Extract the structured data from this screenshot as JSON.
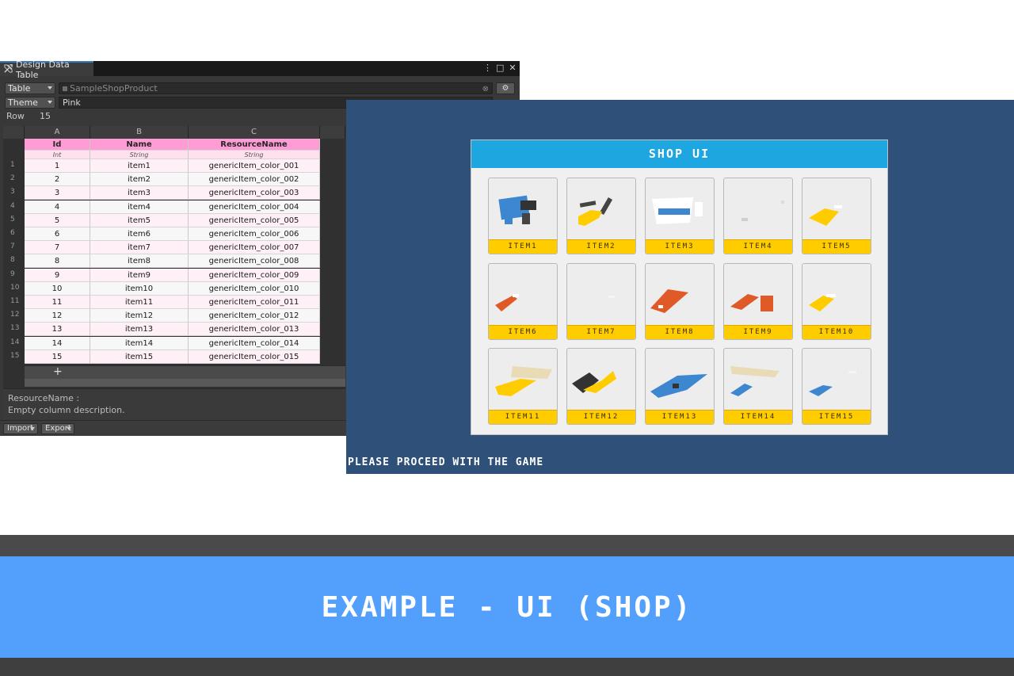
{
  "editor": {
    "tab_title": "Design Data Table",
    "win_buttons": {
      "menu": "⋮",
      "maximize": "□",
      "close": "✕"
    },
    "table_dropdown": "Table",
    "table_source": "SampleShopProduct",
    "theme_dropdown": "Theme",
    "theme_value": "Pink",
    "row_label": "Row",
    "row_value": "15",
    "columns": [
      {
        "letter": "A",
        "name": "Id",
        "type": "Int"
      },
      {
        "letter": "B",
        "name": "Name",
        "type": "String"
      },
      {
        "letter": "C",
        "name": "ResourceName",
        "type": "String"
      }
    ],
    "rows": [
      {
        "num": "1",
        "id": "1",
        "name": "item1",
        "resource": "genericItem_color_001"
      },
      {
        "num": "2",
        "id": "2",
        "name": "item2",
        "resource": "genericItem_color_002"
      },
      {
        "num": "3",
        "id": "3",
        "name": "item3",
        "resource": "genericItem_color_003"
      },
      {
        "num": "4",
        "id": "4",
        "name": "item4",
        "resource": "genericItem_color_004"
      },
      {
        "num": "5",
        "id": "5",
        "name": "item5",
        "resource": "genericItem_color_005"
      },
      {
        "num": "6",
        "id": "6",
        "name": "item6",
        "resource": "genericItem_color_006"
      },
      {
        "num": "7",
        "id": "7",
        "name": "item7",
        "resource": "genericItem_color_007"
      },
      {
        "num": "8",
        "id": "8",
        "name": "item8",
        "resource": "genericItem_color_008"
      },
      {
        "num": "9",
        "id": "9",
        "name": "item9",
        "resource": "genericItem_color_009"
      },
      {
        "num": "10",
        "id": "10",
        "name": "item10",
        "resource": "genericItem_color_010"
      },
      {
        "num": "11",
        "id": "11",
        "name": "item11",
        "resource": "genericItem_color_011"
      },
      {
        "num": "12",
        "id": "12",
        "name": "item12",
        "resource": "genericItem_color_012"
      },
      {
        "num": "13",
        "id": "13",
        "name": "item13",
        "resource": "genericItem_color_013"
      },
      {
        "num": "14",
        "id": "14",
        "name": "item14",
        "resource": "genericItem_color_014"
      },
      {
        "num": "15",
        "id": "15",
        "name": "item15",
        "resource": "genericItem_color_015"
      }
    ],
    "add_row_symbol": "+",
    "description_title": "ResourceName :",
    "description_text": "Empty column description.",
    "import_button": "Import",
    "export_button": "Export",
    "colors": {
      "header_pink": "#ff9cd6",
      "row_pink": "#fff0f7",
      "tab_accent": "#3a79bb"
    }
  },
  "game": {
    "shop_title": "SHOP UI",
    "items": [
      "ITEM1",
      "ITEM2",
      "ITEM3",
      "ITEM4",
      "ITEM5",
      "ITEM6",
      "ITEM7",
      "ITEM8",
      "ITEM9",
      "ITEM10",
      "ITEM11",
      "ITEM12",
      "ITEM13",
      "ITEM14",
      "ITEM15"
    ],
    "footer_text": "PLEASE PROCEED WITH THE GAME",
    "colors": {
      "background": "#2f5079",
      "header": "#1da6e0",
      "label": "#ffcc00"
    }
  },
  "banner": {
    "title": "EXAMPLE - UI (SHOP)",
    "color": "#52a0fc"
  }
}
